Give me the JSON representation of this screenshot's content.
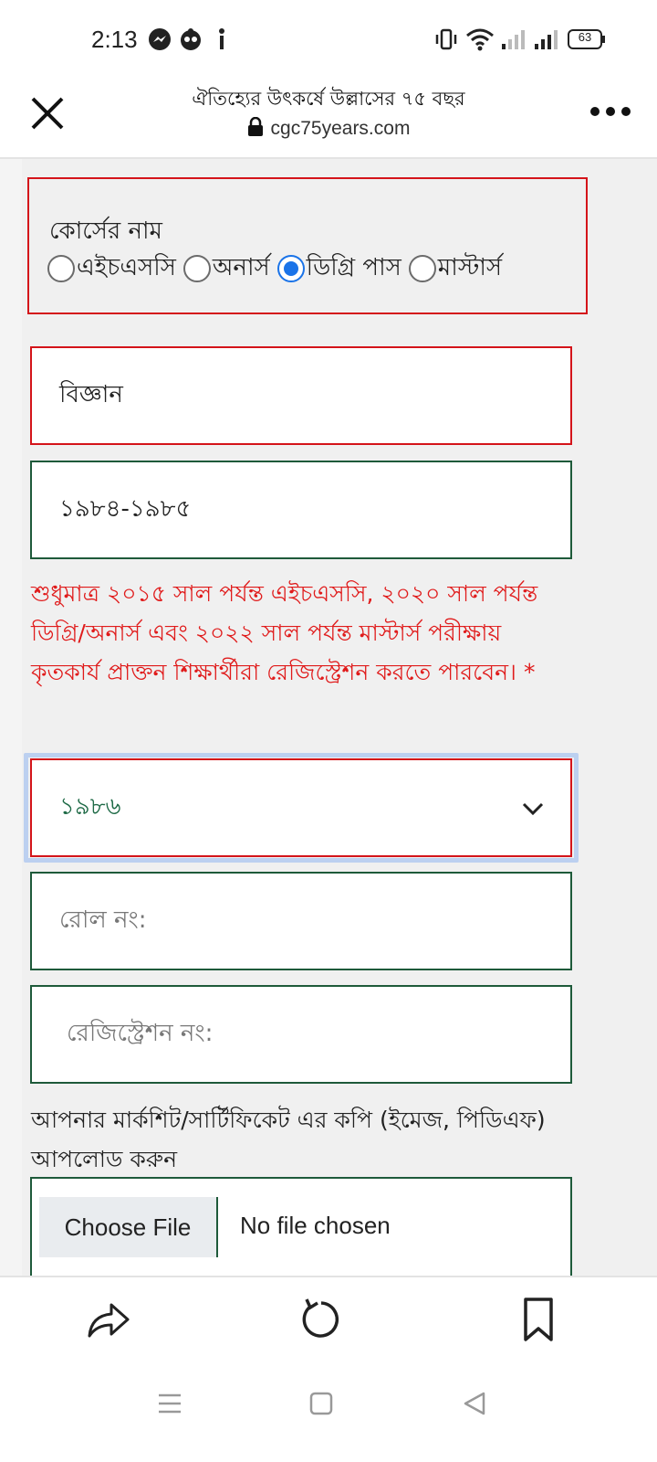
{
  "status_bar": {
    "time": "2:13",
    "battery": "63",
    "icons": [
      "messenger-icon",
      "notification-app-icon",
      "person-icon",
      "vibrate-icon",
      "wifi-icon",
      "signal-icon",
      "signal-icon",
      "battery-icon"
    ]
  },
  "browser": {
    "page_title": "ঐতিহ্যের উৎকর্ষে উল্লাসের ৭৫ বছর",
    "url": "cgc75years.com",
    "close_icon": "close-icon",
    "menu_icon": "more-horizontal-icon"
  },
  "form": {
    "course": {
      "label": "কোর্সের নাম",
      "options": [
        {
          "label": "এইচএসসি",
          "selected": false
        },
        {
          "label": "অনার্স",
          "selected": false
        },
        {
          "label": "ডিগ্রি পাস",
          "selected": true
        },
        {
          "label": "মাস্টার্স",
          "selected": false
        }
      ]
    },
    "group_value": "বিজ্ঞান",
    "session_value": "১৯৮৪-১৯৮৫",
    "notice": "শুধুমাত্র ২০১৫ সাল পর্যন্ত এইচএসসি, ২০২০ সাল পর্যন্ত ডিগ্রি/অনার্স এবং ২০২২ সাল পর্যন্ত মাস্টার্স পরীক্ষায় কৃতকার্য প্রাক্তন শিক্ষার্থীরা রেজিস্ট্রেশন করতে পারবেন। *",
    "year_select": {
      "value": "১৯৮৬"
    },
    "roll_placeholder": "রোল নং:",
    "registration_placeholder": "রেজিস্ট্রেশন নং:",
    "upload_label": "আপনার মার্কশিট/সার্টিফিকেট এর কপি (ইমেজ, পিডিএফ) আপলোড করুন",
    "file": {
      "button_label": "Choose File",
      "status": "No file chosen"
    }
  },
  "colors": {
    "error_red": "#d4141a",
    "field_green": "#1e5a3a",
    "radio_blue": "#1a73e8",
    "focus_ring": "#bcd0f0"
  }
}
